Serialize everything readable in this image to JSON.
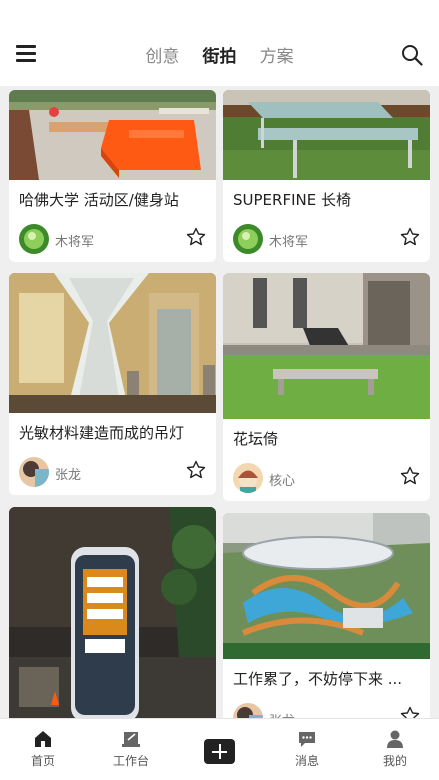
{
  "header": {
    "tabs": [
      {
        "label": "创意",
        "active": false
      },
      {
        "label": "街拍",
        "active": true
      },
      {
        "label": "方案",
        "active": false
      }
    ]
  },
  "feed": {
    "cards": [
      {
        "title": "哈佛大学 活动区/健身站",
        "author": "木将军",
        "image": "orange-sculptural-bench-plaza",
        "avatar": "green-leaf-avatar",
        "star_icon": "star-outline-icon"
      },
      {
        "title": "SUPERFINE 长椅",
        "author": "木将军",
        "image": "concrete-bench-park",
        "avatar": "green-leaf-avatar",
        "star_icon": "star-outline-icon"
      },
      {
        "title": "光敏材料建造而成的吊灯",
        "author": "张龙",
        "image": "hyperboloid-lattice-chandelier",
        "avatar": "photo-avatar",
        "star_icon": "star-outline-icon"
      },
      {
        "title": "花坛倚",
        "author": "核心",
        "image": "concrete-bench-lawn",
        "avatar": "cartoon-avatar",
        "star_icon": "star-outline-icon"
      },
      {
        "title": "",
        "author": "",
        "image": "ev-charging-station-night",
        "avatar": "",
        "star_icon": ""
      },
      {
        "title": "工作累了，不妨停下来 ...",
        "author": "张龙",
        "image": "aerial-garden-pavilion",
        "avatar": "photo-avatar",
        "star_icon": "star-outline-icon"
      }
    ]
  },
  "bottom_nav": {
    "items": [
      {
        "label": "首页",
        "icon": "home-icon"
      },
      {
        "label": "工作台",
        "icon": "workbench-icon"
      },
      {
        "label": "消息",
        "icon": "message-icon"
      },
      {
        "label": "我的",
        "icon": "profile-icon"
      }
    ],
    "add_icon": "add-icon"
  },
  "colors": {
    "accent": "#222222",
    "background": "#efefef",
    "muted": "#888888"
  }
}
